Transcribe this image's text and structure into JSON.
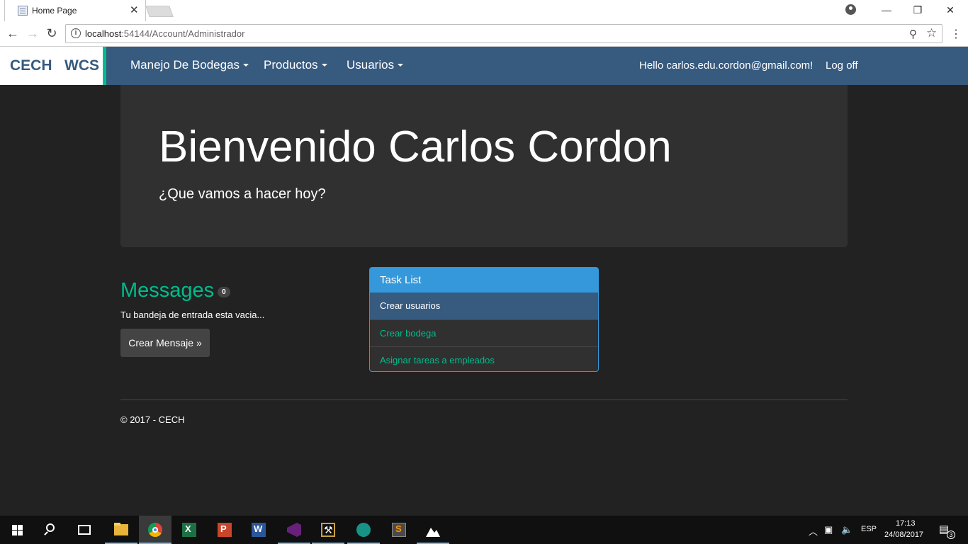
{
  "browser": {
    "tab_title": "Home Page",
    "url_host": "localhost",
    "url_path": ":54144/Account/Administrador"
  },
  "navbar": {
    "brand": "CECH   WCS",
    "menus": [
      {
        "label": "Manejo De Bodegas"
      },
      {
        "label": "Productos"
      },
      {
        "label": "Usuarios"
      }
    ],
    "greeting": "Hello carlos.edu.cordon@gmail.com!",
    "logoff": "Log off"
  },
  "jumbotron": {
    "title": "Bienvenido Carlos Cordon",
    "subtitle": "¿Que vamos a hacer hoy?"
  },
  "messages": {
    "title": "Messages",
    "count": "0",
    "empty_text": "Tu bandeja de entrada esta vacia...",
    "button": "Crear Mensaje »"
  },
  "task_list": {
    "header": "Task List",
    "items": [
      {
        "label": "Crear usuarios"
      },
      {
        "label": "Crear bodega"
      },
      {
        "label": "Asignar tareas a empleados"
      }
    ]
  },
  "footer": {
    "text": "© 2017 - CECH"
  },
  "taskbar": {
    "language": "ESP",
    "time": "17:13",
    "date": "24/08/2017",
    "notifications": "3"
  },
  "colors": {
    "navbar": "#375a7f",
    "accent": "#00bc8c",
    "panel_header": "#3498db",
    "background": "#222222"
  }
}
